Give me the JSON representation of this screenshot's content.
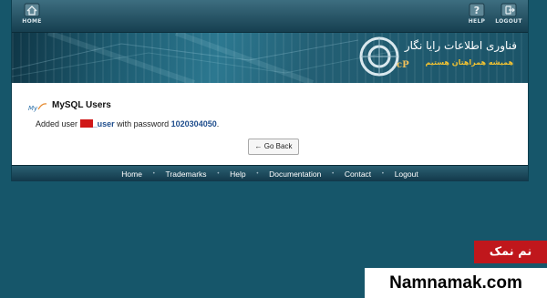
{
  "toolbar": {
    "home_label": "HOME",
    "help_label": "HELP",
    "logout_label": "LOGOUT"
  },
  "banner": {
    "title": "فناوری اطلاعات رایا نگار",
    "subtitle": "همیشه همراهتان هستیم",
    "logo_text": "cP"
  },
  "content": {
    "title": "MySQL Users",
    "message_prefix": "Added user",
    "username_suffix": "_user",
    "message_mid": "with password",
    "password": "1020304050",
    "message_end": ".",
    "go_back_label": "← Go Back"
  },
  "footer": {
    "links": [
      "Home",
      "Trademarks",
      "Help",
      "Documentation",
      "Contact",
      "Logout"
    ]
  },
  "watermark": {
    "persian": "نم نمک",
    "site": "Namnamak.com"
  },
  "colors": {
    "page_bg": "#16566a",
    "redaction": "#d01818",
    "banner_subtitle": "#f1c232",
    "watermark_red": "#c0171c"
  }
}
